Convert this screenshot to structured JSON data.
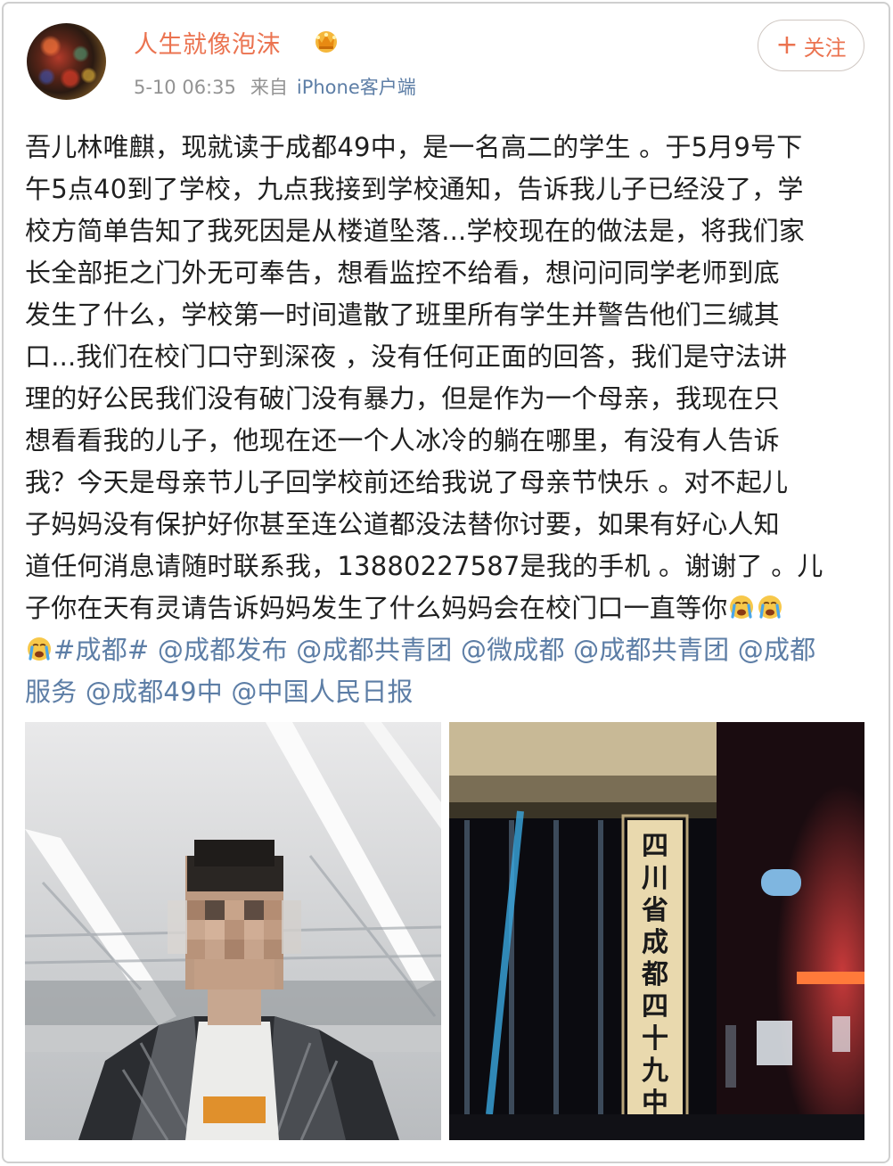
{
  "user": {
    "name": "人生就像泡沫",
    "badge_icon": "crown-icon",
    "date": "5-10 06:35",
    "from_label": "来自",
    "source": "iPhone客户端"
  },
  "follow_button": {
    "plus": "+",
    "label": "关注"
  },
  "post": {
    "lines": [
      "吾儿林唯麒，现就读于成都49中，是一名高二的学生 。于5月9号下",
      "午5点40到了学校，九点我接到学校通知，告诉我儿子已经没了，学",
      "校方简单告知了我死因是从楼道坠落...学校现在的做法是，将我们家",
      "长全部拒之门外无可奉告，想看监控不给看，想问问同学老师到底",
      "发生了什么，学校第一时间遣散了班里所有学生并警告他们三缄其",
      "口...我们在校门口守到深夜 ，没有任何正面的回答，我们是守法讲",
      "理的好公民我们没有破门没有暴力，但是作为一个母亲，我现在只",
      "想看看我的儿子，他现在还一个人冰冷的躺在哪里，有没有人告诉",
      "我？今天是母亲节儿子回学校前还给我说了母亲节快乐 。对不起儿",
      "子妈妈没有保护好你甚至连公道都没法替你讨要，如果有好心人知",
      "道任何消息请随时联系我，13880227587是我的手机 。谢谢了 。儿",
      "子你在天有灵请告诉妈妈发生了什么妈妈会在校门口一直等你"
    ],
    "tag": "#成都#",
    "mentions": [
      "@成都发布",
      "@成都共青团",
      "@微成都",
      "@成都共青团",
      "@成都",
      "服务",
      "@成都49中",
      "@中国人民日报"
    ],
    "emoji_icon": "crying-face-icon"
  },
  "photos": {
    "photo1_alt_icon": "portrait-photo",
    "photo2_sign_chars": [
      "四",
      "川",
      "省",
      "成",
      "都",
      "四",
      "十",
      "九",
      "中"
    ]
  },
  "colors": {
    "username": "#eb7350",
    "link": "#5d7ea6",
    "meta": "#939393",
    "text": "#202020"
  }
}
